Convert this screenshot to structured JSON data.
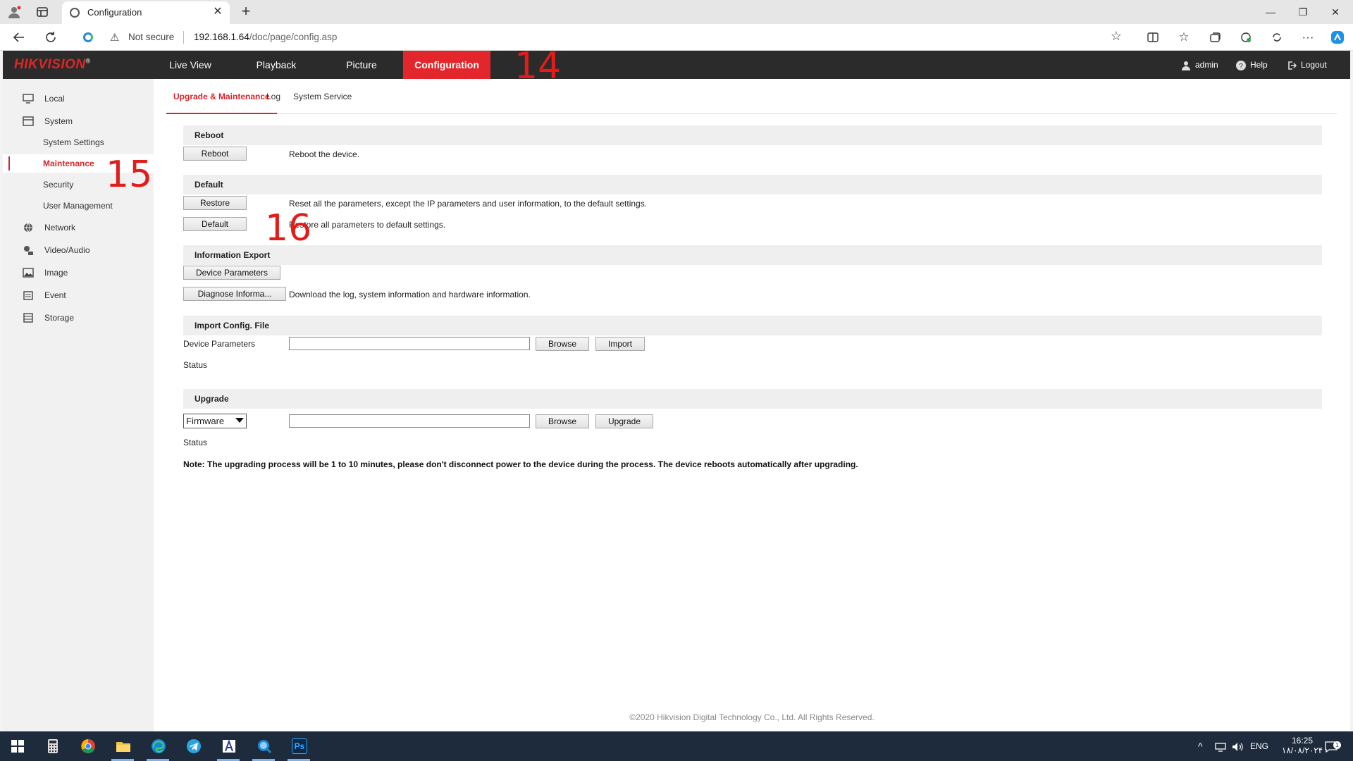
{
  "browser": {
    "tab_title": "Configuration",
    "tab_close": "✕",
    "new_tab": "+",
    "window_controls": {
      "minimize": "—",
      "maximize": "❐",
      "close": "✕"
    },
    "security_label": "Not secure",
    "url_host": "192.168.1.64",
    "url_path": "/doc/page/config.asp",
    "icons": [
      "back-icon",
      "reload-icon",
      "star-icon",
      "split-screen-icon",
      "favorites-icon",
      "collections-icon",
      "extensions-icon",
      "more-icon",
      "copilot-icon"
    ],
    "more_label": "···"
  },
  "topnav": {
    "logo": "HIKVISION",
    "logo_mark": "®",
    "items": [
      "Live View",
      "Playback",
      "Picture",
      "Configuration"
    ],
    "active": "Configuration",
    "user": "admin",
    "help": "Help",
    "logout": "Logout",
    "annotation": "14"
  },
  "sidebar": {
    "items": [
      {
        "label": "Local",
        "icon": "monitor-icon"
      },
      {
        "label": "System",
        "icon": "system-icon"
      },
      {
        "label": "System Settings"
      },
      {
        "label": "Maintenance",
        "active": true
      },
      {
        "label": "Security"
      },
      {
        "label": "User Management"
      },
      {
        "label": "Network",
        "icon": "globe-icon"
      },
      {
        "label": "Video/Audio",
        "icon": "video-audio-icon"
      },
      {
        "label": "Image",
        "icon": "image-icon"
      },
      {
        "label": "Event",
        "icon": "event-icon"
      },
      {
        "label": "Storage",
        "icon": "storage-icon"
      }
    ],
    "annotation": "15"
  },
  "subtabs": [
    "Upgrade & Maintenance",
    "Log",
    "System Service"
  ],
  "reboot": {
    "title": "Reboot",
    "button": "Reboot",
    "desc": "Reboot the device."
  },
  "default": {
    "title": "Default",
    "restore_button": "Restore",
    "restore_desc": "Reset all the parameters, except the IP parameters and user information, to the default settings.",
    "default_button": "Default",
    "default_desc": "Restore all parameters to default settings.",
    "annotation": "16"
  },
  "export": {
    "title": "Information Export",
    "device_params_button": "Device Parameters",
    "diagnose_button": "Diagnose Informa...",
    "diagnose_desc": "Download the log, system information and hardware information."
  },
  "import": {
    "title": "Import Config. File",
    "label": "Device Parameters",
    "file_value": "",
    "browse": "Browse",
    "import": "Import",
    "status_label": "Status"
  },
  "upgrade": {
    "title": "Upgrade",
    "select_value": "Firmware",
    "file_value": "",
    "browse": "Browse",
    "upgrade": "Upgrade",
    "status_label": "Status",
    "note": "Note: The upgrading process will be 1 to 10 minutes, please don't disconnect power to the device during the process. The device reboots automatically after upgrading."
  },
  "footer": "©2020 Hikvision Digital Technology Co., Ltd. All Rights Reserved.",
  "taskbar": {
    "apps": [
      "start-icon",
      "calculator-icon",
      "chrome-icon",
      "file-explorer-icon",
      "edge-icon",
      "telegram-icon",
      "app-icon",
      "search-app-icon",
      "photoshop-icon"
    ],
    "photoshop_label": "Ps",
    "language": "ENG",
    "time": "16:25",
    "date": "۱۸/۰۸/۲۰۲۴",
    "notification_count": "1"
  }
}
